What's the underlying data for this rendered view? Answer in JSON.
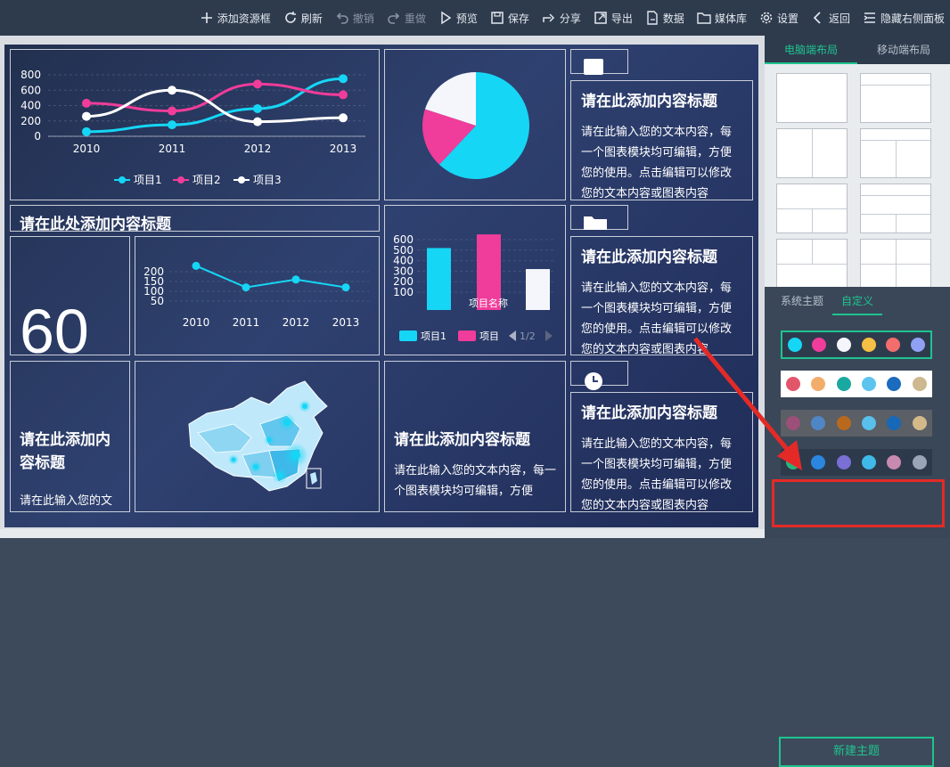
{
  "toolbar": {
    "items": [
      {
        "label": "添加资源框",
        "icon": "plus-icon"
      },
      {
        "label": "刷新",
        "icon": "refresh-icon"
      },
      {
        "label": "撤销",
        "icon": "undo-icon"
      },
      {
        "label": "重做",
        "icon": "redo-icon"
      },
      {
        "label": "预览",
        "icon": "play-icon"
      },
      {
        "label": "保存",
        "icon": "save-icon"
      },
      {
        "label": "分享",
        "icon": "share-icon"
      },
      {
        "label": "导出",
        "icon": "export-icon"
      },
      {
        "label": "数据",
        "icon": "data-icon"
      },
      {
        "label": "媒体库",
        "icon": "folder-icon"
      },
      {
        "label": "设置",
        "icon": "gear-icon"
      },
      {
        "label": "返回",
        "icon": "back-icon"
      },
      {
        "label": "隐藏右侧面板",
        "icon": "menu-icon"
      }
    ]
  },
  "colors": {
    "cyan": "#16d6f5",
    "pink": "#f03c9a",
    "white": "#f4f6fb",
    "accent": "#1ec48f",
    "red": "#e42a27"
  },
  "line_chart": {
    "chart_data": {
      "type": "line",
      "x": [
        "2010",
        "2011",
        "2012",
        "2013"
      ],
      "y_ticks": [
        "800",
        "600",
        "400",
        "200",
        "0"
      ],
      "ylim": [
        0,
        800
      ],
      "series": [
        {
          "name": "项目1",
          "values": [
            60,
            150,
            360,
            750
          ],
          "color": "#16d6f5"
        },
        {
          "name": "项目2",
          "values": [
            430,
            330,
            680,
            540
          ],
          "color": "#f03c9a"
        },
        {
          "name": "项目3",
          "values": [
            260,
            600,
            190,
            240
          ],
          "color": "#ffffff"
        }
      ]
    }
  },
  "pie_chart": {
    "chart_data": {
      "type": "pie",
      "values": [
        62,
        18,
        20
      ],
      "colors": [
        "#16d6f5",
        "#f03c9a",
        "#f4f6fb"
      ]
    }
  },
  "small_line": {
    "chart_data": {
      "type": "line",
      "x": [
        "2010",
        "2011",
        "2012",
        "2013"
      ],
      "y_ticks": [
        "200",
        "150",
        "100",
        "50"
      ],
      "values": [
        230,
        120,
        160,
        120
      ],
      "color": "#16d6f5"
    }
  },
  "bar_chart": {
    "chart_data": {
      "type": "bar",
      "y_ticks": [
        "600",
        "500",
        "400",
        "300",
        "200",
        "100"
      ],
      "xlabel": "项目名称",
      "values": [
        520,
        650,
        320
      ],
      "colors": [
        "#16d6f5",
        "#f03c9a",
        "#f4f6fb"
      ],
      "legend": [
        "项目1",
        "项目"
      ],
      "pager": "1/2"
    }
  },
  "cells": {
    "title_strip": "请在此处添加内容标题",
    "big_number": "60",
    "left_bottom_title": "请在此添加内容标题",
    "left_bottom_text": "请在此输入您的文",
    "mid_bottom_title": "请在此添加内容标题",
    "mid_bottom_text": "请在此输入您的文本内容，每一个图表模块均可编辑，方便",
    "right_title": "请在此添加内容标题",
    "right_text": "请在此输入您的文本内容，每一个图表模块均可编辑，方便您的使用。点击编辑可以修改您的文本内容或图表内容"
  },
  "panel": {
    "tabs": [
      "电脑端布局",
      "移动端布局"
    ],
    "theme_tabs": [
      "系统主题",
      "自定义"
    ],
    "theme_rows": [
      {
        "bg": "#2e3b4d",
        "colors": [
          "#16d6f5",
          "#f03c9a",
          "#f4f6fb",
          "#f5c044",
          "#f36d6d",
          "#8fa0f5"
        ]
      },
      {
        "bg": "#ffffff",
        "colors": [
          "#e2566b",
          "#f2ad6b",
          "#1aa9a0",
          "#5bc4ef",
          "#1b6bbf",
          "#cdb88f"
        ]
      },
      {
        "bg": "#5b5f66",
        "colors": [
          "#9c4f79",
          "#4f86c6",
          "#b8691e",
          "#58c0ea",
          "#1769b8",
          "#d3b98a"
        ]
      },
      {
        "bg": "#2d3a4c",
        "colors": [
          "#27b57e",
          "#2b86e0",
          "#7a6fd4",
          "#3fb9e8",
          "#c98aaf",
          "#9aa6b8"
        ]
      }
    ],
    "new_theme": "新建主题"
  }
}
